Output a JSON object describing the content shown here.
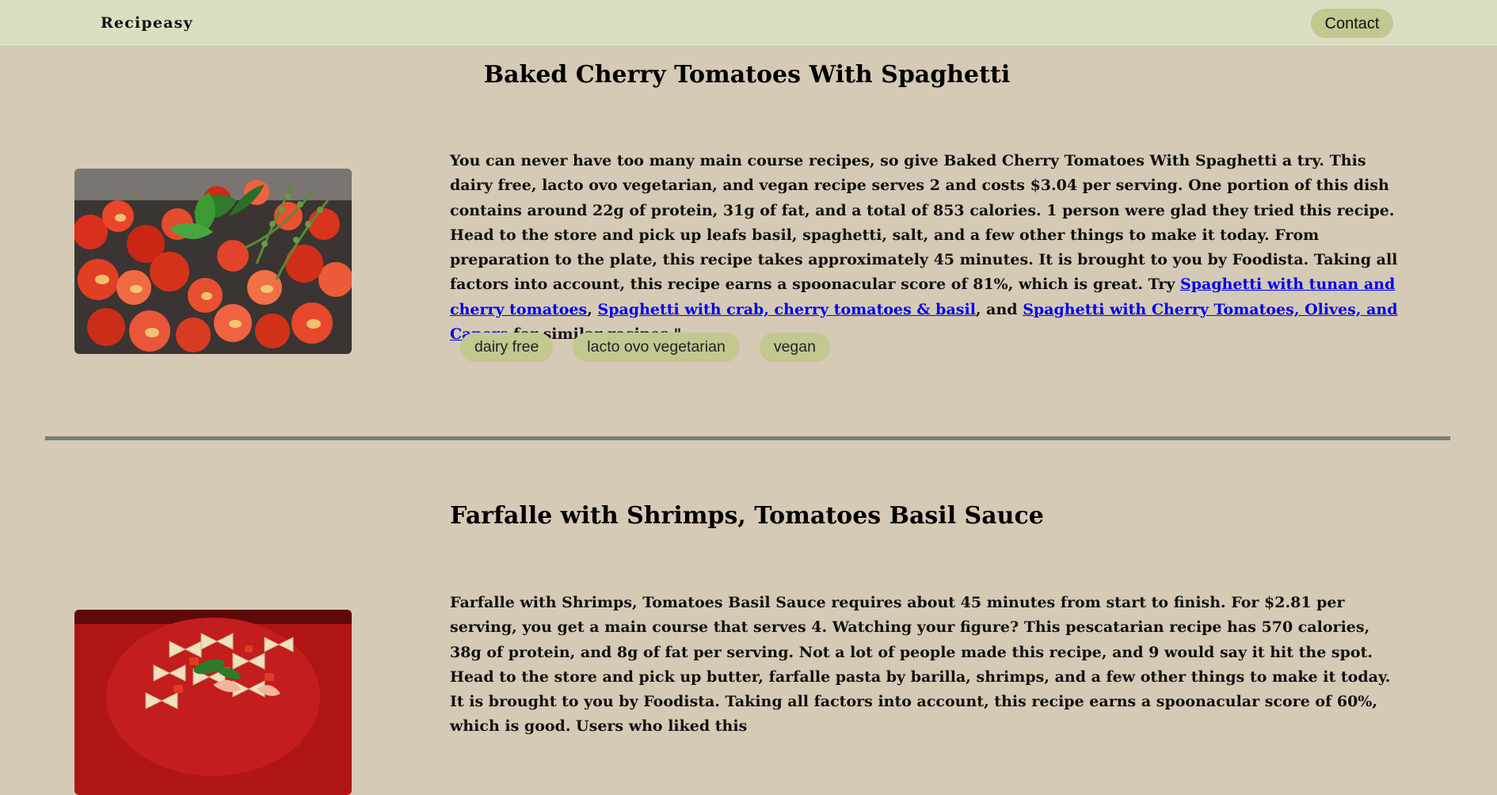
{
  "nav": {
    "brand": "Recipeasy",
    "contact_label": "Contact"
  },
  "recipes": [
    {
      "title": "Baked Cherry Tomatoes With Spaghetti",
      "image_alt": "Baked cherry tomatoes with basil and thyme",
      "summary": {
        "intro": "You can never have too many main course recipes, so give Baked Cherry Tomatoes With Spaghetti a try. This dairy free, lacto ovo vegetarian, and vegan recipe serves 2 and costs $3.04 per serving. One portion of this dish contains around 22g of protein, 31g of fat, and a total of 853 calories. 1 person were glad they tried this recipe. Head to the store and pick up leafs basil, spaghetti, salt, and a few other things to make it today. From preparation to the plate, this recipe takes approximately 45 minutes. It is brought to you by Foodista. Taking all factors into account, this recipe earns a spoonacular score of 81%, which is great. Try ",
        "link1": "Spaghetti with tunan and cherry tomatoes",
        "sep1": ", ",
        "link2": "Spaghetti with crab, cherry tomatoes & basil",
        "sep2": ", and ",
        "link3": "Spaghetti with Cherry Tomatoes, Olives, and Capers",
        "outro": " for similar recipes.\""
      },
      "tags": [
        "dairy free",
        "lacto ovo vegetarian",
        "vegan"
      ]
    },
    {
      "title": "Farfalle with Shrimps, Tomatoes Basil Sauce",
      "image_alt": "Farfalle pasta with shrimps and tomatoes on a red plate",
      "summary": {
        "text": "Farfalle with Shrimps, Tomatoes Basil Sauce requires about 45 minutes from start to finish. For $2.81 per serving, you get a main course that serves 4. Watching your figure? This pescatarian recipe has 570 calories, 38g of protein, and 8g of fat per serving. Not a lot of people made this recipe, and 9 would say it hit the spot. Head to the store and pick up butter, farfalle pasta by barilla, shrimps, and a few other things to make it today. It is brought to you by Foodista. Taking all factors into account, this recipe earns a spoonacular score of 60%, which is good. Users who liked this"
      }
    }
  ],
  "colors": {
    "page_bg": "#d5cab5",
    "navbar_bg": "#dadfc2",
    "pill_bg": "#c2c890",
    "link": "#0000ee",
    "divider": "#7b7b78"
  }
}
